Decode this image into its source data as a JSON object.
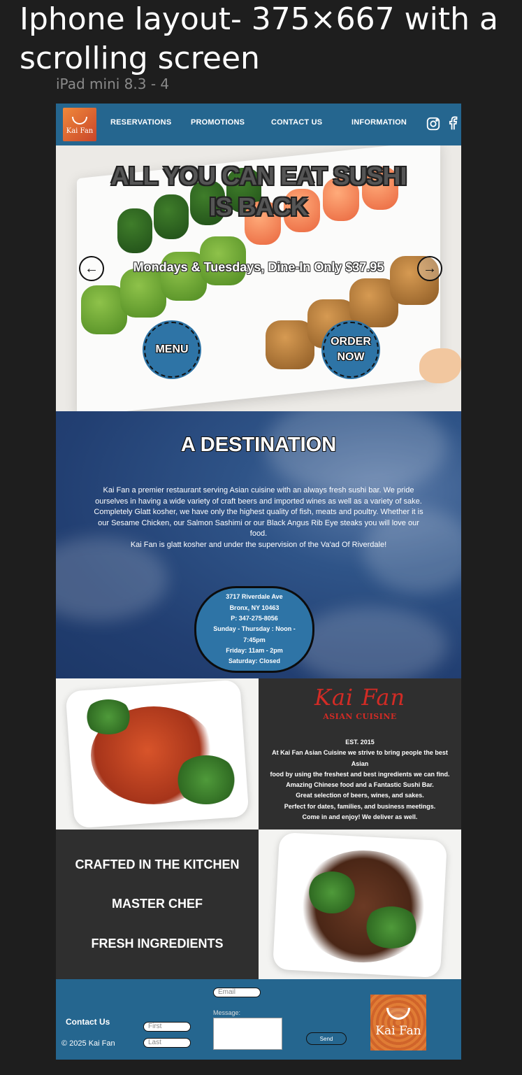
{
  "canvas": {
    "title": "Iphone layout- 375×667 with a scrolling screen",
    "frame_label": "iPad mini 8.3 - 4"
  },
  "nav": {
    "logo_text": "Kai Fan",
    "links": [
      "RESERVATIONS",
      "PROMOTIONS",
      "CONTACT US",
      "INFORMATION"
    ],
    "icons": [
      "instagram-icon",
      "facebook-icon"
    ],
    "bg_color": "#25668f"
  },
  "hero": {
    "title_line1": "ALL YOU CAN EAT SUSHI",
    "title_line2": "IS BACK",
    "subtitle": "Mondays & Tuesdays, Dine-In Only $37.95",
    "prev_arrow": "←",
    "next_arrow": "→",
    "menu_button": "MENU",
    "order_button_line1": "ORDER",
    "order_button_line2": "NOW"
  },
  "destination": {
    "title": "A DESTINATION",
    "paragraphs": [
      "Kai Fan a premier restaurant serving Asian cuisine with an always fresh sushi bar. We pride ourselves in having a wide variety of craft beers and imported wines as well as a variety of sake.",
      "Completely Glatt kosher, we have only the highest quality of fish, meats and poultry. Whether it is our Sesame Chicken, our Salmon Sashimi or our Black Angus Rib Eye steaks you will love our food.",
      "Kai Fan is glatt kosher and under the supervision of the Va'ad Of Riverdale!"
    ],
    "address_lines": [
      "3717 Riverdale Ave",
      "Bronx, NY 10463",
      "P: 347-275-8056",
      "Sunday - Thursday : Noon -",
      "7:45pm",
      "Friday:  11am - 2pm",
      "Saturday:  Closed"
    ]
  },
  "about": {
    "logo_text": "Kai Fan",
    "logo_sub": "ASIAN CUISINE",
    "lines": [
      "EST. 2015",
      "At Kai Fan Asian Cuisine we strive to bring people the best Asian",
      "food by using the freshest and best ingredients we can find.",
      "Amazing Chinese food and a Fantastic Sushi Bar.",
      "Great selection of beers, wines, and sakes.",
      "Perfect for dates, families, and business meetings.",
      "Come in and enjoy! We deliver as well."
    ]
  },
  "crafted": {
    "items": [
      "CRAFTED IN THE KITCHEN",
      "MASTER CHEF",
      "FRESH INGREDIENTS"
    ]
  },
  "footer": {
    "contact_label": "Contact Us",
    "copyright": "© 2025 Kai Fan",
    "first_placeholder": "First",
    "last_placeholder": "Last",
    "email_placeholder": "Email",
    "message_label": "Message:",
    "send_label": "Send",
    "logo_text": "Kai Fan"
  }
}
